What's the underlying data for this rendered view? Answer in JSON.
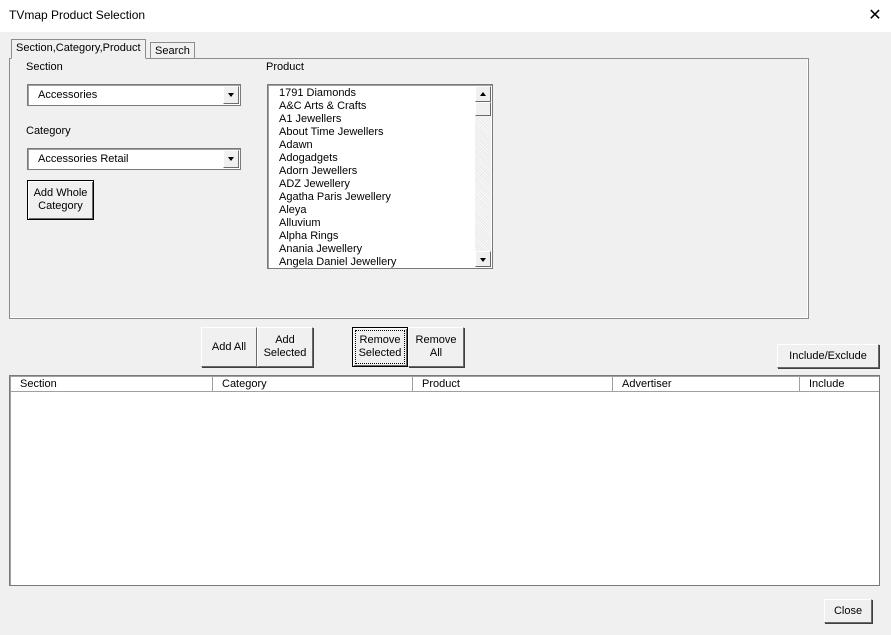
{
  "window": {
    "title": "TVmap Product Selection",
    "close_glyph": "✕"
  },
  "tabs": [
    {
      "label": "Section,Category,Product"
    },
    {
      "label": "Search"
    }
  ],
  "section": {
    "label": "Section",
    "value": "Accessories"
  },
  "category": {
    "label": "Category",
    "value": "Accessories Retail"
  },
  "add_whole_category": {
    "label_line1": "Add Whole",
    "label_line2": "Category"
  },
  "product": {
    "label": "Product",
    "items": [
      "1791 Diamonds",
      "A&C Arts & Crafts",
      "A1 Jewellers",
      "About Time Jewellers",
      "Adawn",
      "Adogadgets",
      "Adorn Jewellers",
      "ADZ Jewellery",
      "Agatha Paris Jewellery",
      "Aleya",
      "Alluvium",
      "Alpha Rings",
      "Anania Jewellery",
      "Angela Daniel Jewellery"
    ]
  },
  "actions": {
    "add_all": "Add All",
    "add_selected_1": "Add",
    "add_selected_2": "Selected",
    "remove_selected_1": "Remove",
    "remove_selected_2": "Selected",
    "remove_all_1": "Remove",
    "remove_all_2": "All",
    "include_exclude": "Include/Exclude"
  },
  "results": {
    "columns": [
      "Section",
      "Category",
      "Product",
      "Advertiser",
      "Include"
    ],
    "rows": []
  },
  "footer": {
    "close": "Close"
  }
}
